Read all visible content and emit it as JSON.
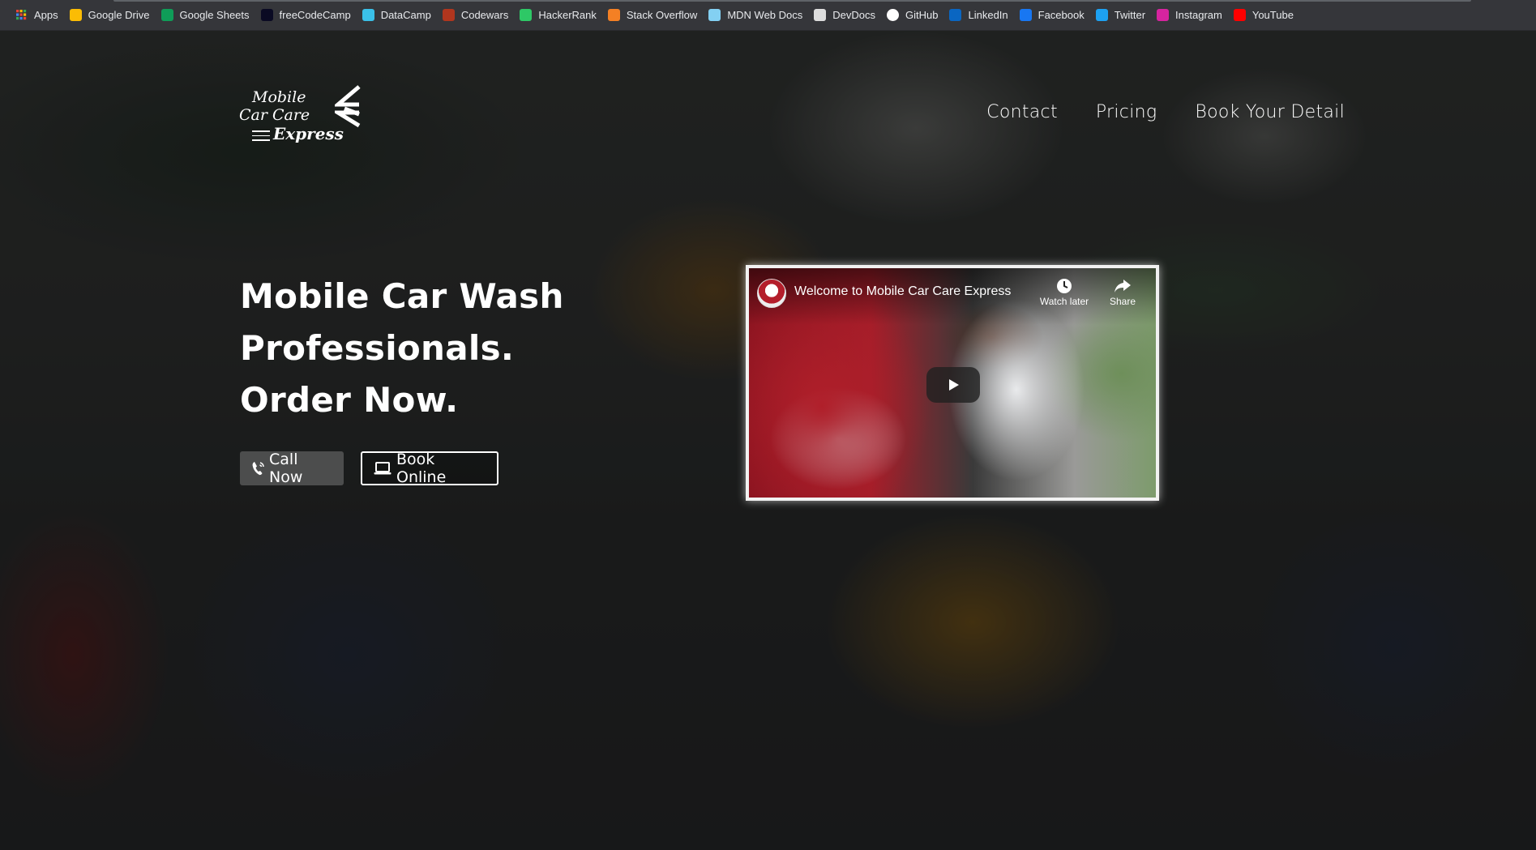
{
  "bookmarks": [
    {
      "label": "Apps",
      "icon": "apps-grid-icon",
      "color": "#ea4335"
    },
    {
      "label": "Google Drive",
      "icon": "google-drive-icon",
      "color": "#fbbc04"
    },
    {
      "label": "Google Sheets",
      "icon": "google-sheets-icon",
      "color": "#0f9d58"
    },
    {
      "label": "freeCodeCamp",
      "icon": "freecodecamp-icon",
      "color": "#0a0a23"
    },
    {
      "label": "DataCamp",
      "icon": "datacamp-icon",
      "color": "#3ac0e8"
    },
    {
      "label": "Codewars",
      "icon": "codewars-icon",
      "color": "#b1361e"
    },
    {
      "label": "HackerRank",
      "icon": "hackerrank-icon",
      "color": "#2ec866"
    },
    {
      "label": "Stack Overflow",
      "icon": "stackoverflow-icon",
      "color": "#f48024"
    },
    {
      "label": "MDN Web Docs",
      "icon": "mdn-icon",
      "color": "#83d0f2"
    },
    {
      "label": "DevDocs",
      "icon": "devdocs-icon",
      "color": "#dddddd"
    },
    {
      "label": "GitHub",
      "icon": "github-icon",
      "color": "#ffffff"
    },
    {
      "label": "LinkedIn",
      "icon": "linkedin-icon",
      "color": "#0a66c2"
    },
    {
      "label": "Facebook",
      "icon": "facebook-icon",
      "color": "#1877f2"
    },
    {
      "label": "Twitter",
      "icon": "twitter-icon",
      "color": "#1da1f2"
    },
    {
      "label": "Instagram",
      "icon": "instagram-icon",
      "color": "#d6249f"
    },
    {
      "label": "YouTube",
      "icon": "youtube-icon",
      "color": "#ff0000"
    }
  ],
  "logo": {
    "line1": "Mobile",
    "line2": "Car Care",
    "line3": "Express"
  },
  "nav": {
    "contact": "Contact",
    "pricing": "Pricing",
    "book": "Book Your Detail"
  },
  "hero": {
    "line1": "Mobile Car Wash",
    "line2": "Professionals.",
    "line3": "Order Now.",
    "call_label": "Call Now",
    "book_label": "Book Online"
  },
  "video": {
    "title": "Welcome to Mobile Car Care Express",
    "watch_later": "Watch later",
    "share": "Share"
  }
}
